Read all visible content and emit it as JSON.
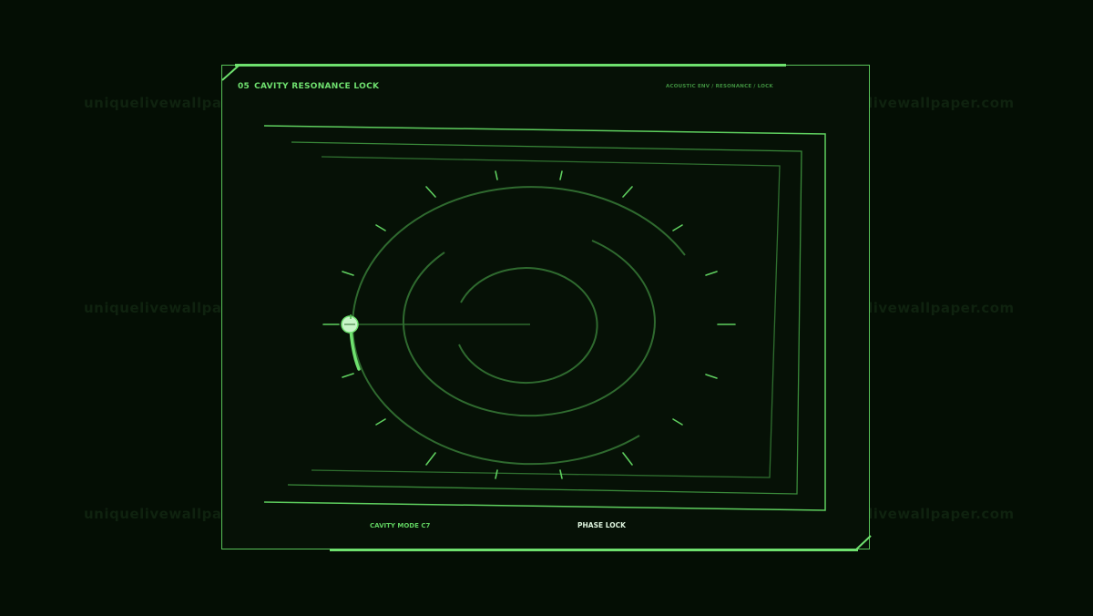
{
  "panel": {
    "number": "05",
    "title": "CAVITY RESONANCE LOCK",
    "breadcrumb": "ACOUSTIC ENV / RESONANCE / LOCK"
  },
  "footer": {
    "mode_label": "CAVITY MODE C7",
    "status_label": "PHASE LOCK"
  },
  "watermark": {
    "text": "uniquelivewallpaper.com"
  },
  "colors": {
    "background": "#040e04",
    "panel_border": "#58c258",
    "accent": "#6ee06e",
    "dim_line": "#2f6a2f",
    "indicator": "#c8f5c8"
  },
  "icons": {
    "corner_top_left": "corner-bracket-icon",
    "corner_bottom_right": "corner-bracket-icon",
    "phase_marker": "phase-marker-icon"
  }
}
